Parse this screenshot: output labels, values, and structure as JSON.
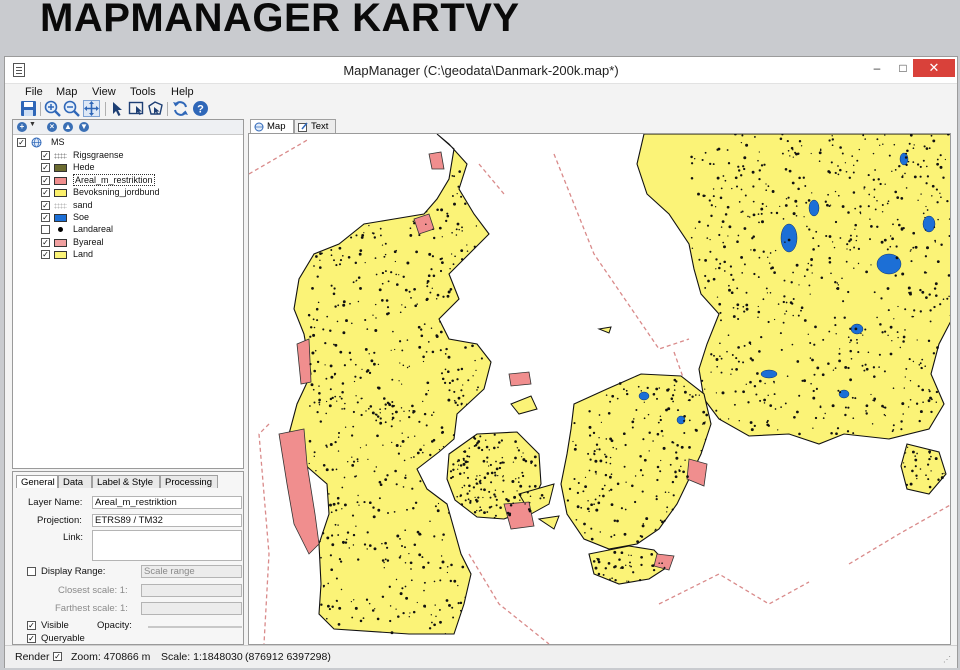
{
  "slide": {
    "title": "MAPMANAGER KARTVY"
  },
  "window": {
    "title": "MapManager (C:\\geodata\\Danmark-200k.map*)",
    "minimize": "–",
    "maximize": "□",
    "close": "✕"
  },
  "menu": [
    "File",
    "Map",
    "View",
    "Tools",
    "Help"
  ],
  "toolbar": {
    "icons": [
      "save-icon",
      "zoom-in-icon",
      "zoom-out-icon",
      "pan-icon",
      "select-arrow-icon",
      "select-rectangle-icon",
      "select-polygon-icon",
      "refresh-icon",
      "help-icon"
    ]
  },
  "layers": {
    "root": "MS",
    "items": [
      {
        "name": "Rigsgraense",
        "checked": true,
        "symbol": "dots",
        "color": "#9a9a9a"
      },
      {
        "name": "Hede",
        "checked": true,
        "symbol": "fill",
        "color": "#6b6b2f"
      },
      {
        "name": "Areal_m_restriktion",
        "checked": true,
        "symbol": "fill",
        "color": "#f08e8e",
        "selected": true
      },
      {
        "name": "Bevoksning_jordbund",
        "checked": true,
        "symbol": "fill",
        "color": "#fbf06c"
      },
      {
        "name": "sand",
        "checked": true,
        "symbol": "dots",
        "color": "#c0c0c0"
      },
      {
        "name": "Soe",
        "checked": true,
        "symbol": "fill",
        "color": "#1c6fd6"
      },
      {
        "name": "Landareal",
        "checked": false,
        "symbol": "point",
        "color": "#000000"
      },
      {
        "name": "Byareal",
        "checked": true,
        "symbol": "fill",
        "color": "#f0a0a0"
      },
      {
        "name": "Land",
        "checked": true,
        "symbol": "fill",
        "color": "#fbf377"
      }
    ]
  },
  "properties": {
    "tabs": [
      "General",
      "Data",
      "Label & Style",
      "Processing"
    ],
    "layer_name_label": "Layer Name:",
    "layer_name": "Areal_m_restriktion",
    "projection_label": "Projection:",
    "projection": "ETRS89 / TM32",
    "link_label": "Link:",
    "link": "",
    "display_range_label": "Display Range:",
    "scale_range": "Scale range",
    "closest_scale_label": "Closest scale: 1:",
    "farthest_scale_label": "Farthest scale: 1:",
    "visible_label": "Visible",
    "opacity_label": "Opacity:",
    "queryable_label": "Queryable"
  },
  "map_tabs": [
    "Map",
    "Text"
  ],
  "status": {
    "render_label": "Render",
    "zoom": "Zoom: 470866 m",
    "scale": "Scale: 1:1848030",
    "coords": "(876912  6397298)"
  },
  "colors": {
    "land": "#fbf377",
    "restriction": "#f08e8e",
    "lake": "#1c6fd6",
    "border": "#d98a8a"
  }
}
